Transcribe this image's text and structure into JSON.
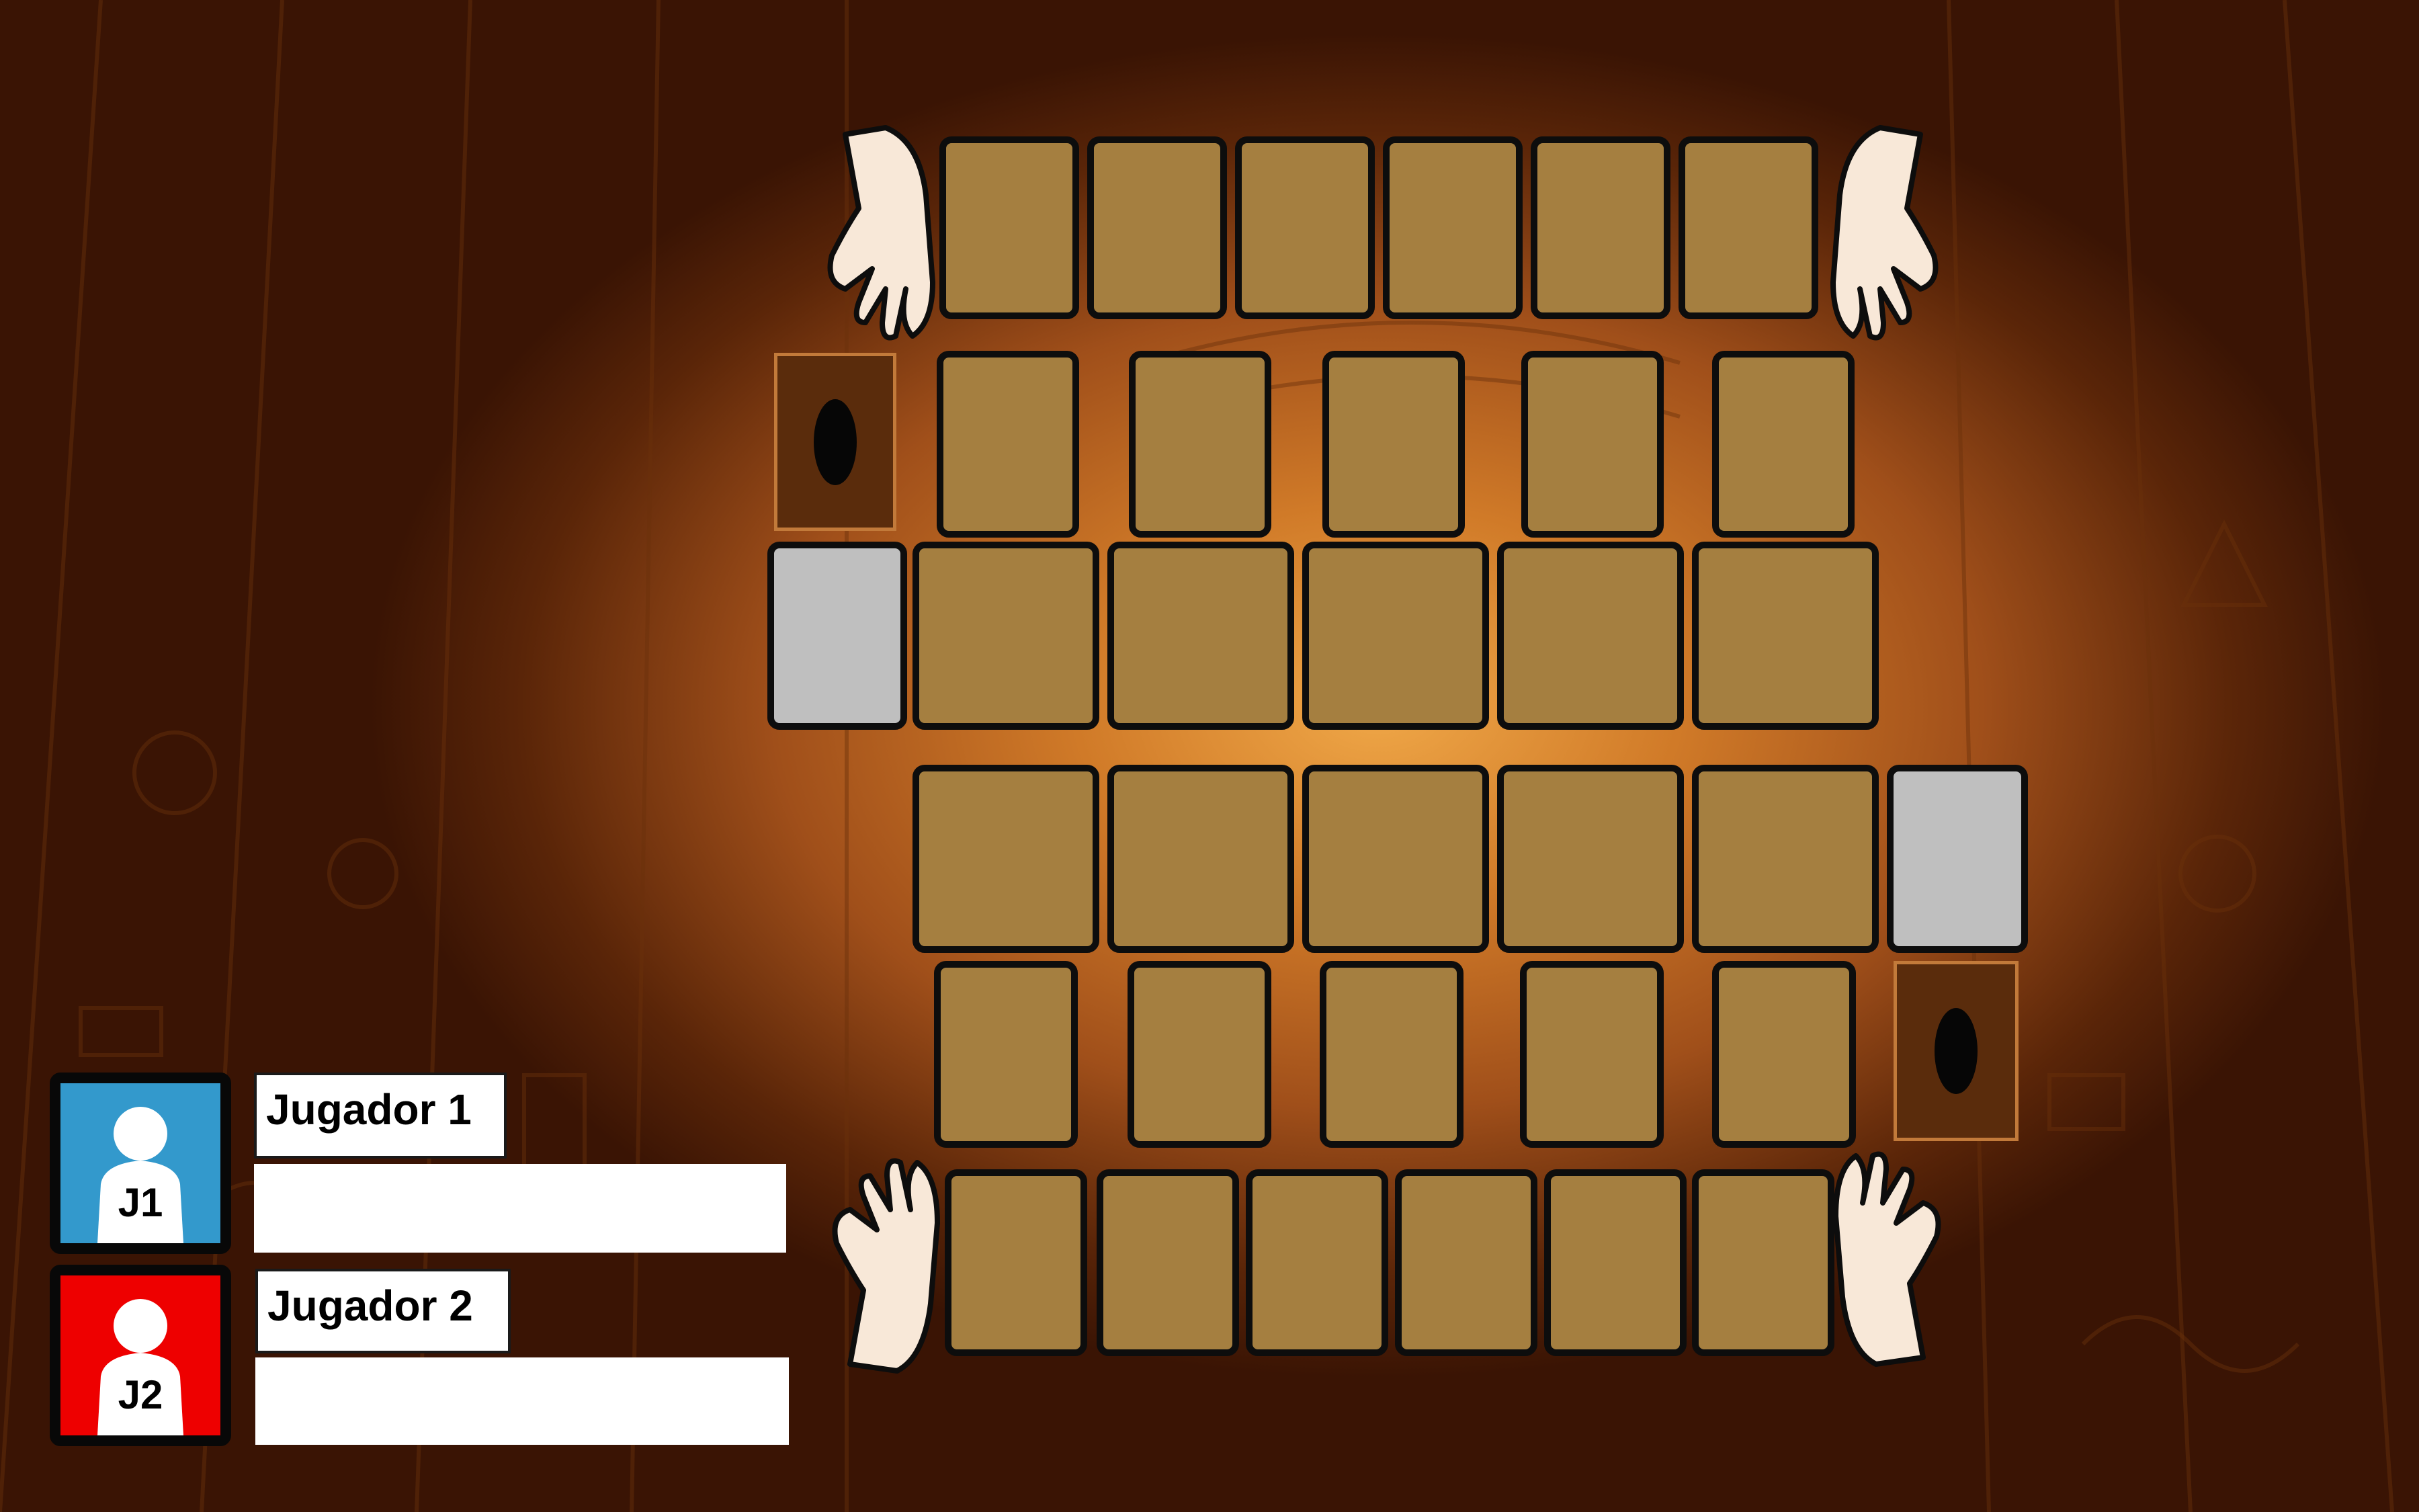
{
  "players": [
    {
      "tag": "J1",
      "name": "Jugador 1",
      "color": "#3399cc",
      "score_value": ""
    },
    {
      "tag": "J2",
      "name": "Jugador 2",
      "color": "#ee0000",
      "score_value": ""
    }
  ],
  "board": {
    "card_color": "#a57f40",
    "empty_zone_color": "#bfbfbf",
    "deck_color": "#5a2c0c",
    "background_theme": "egyptian-hieroglyph-wall"
  }
}
